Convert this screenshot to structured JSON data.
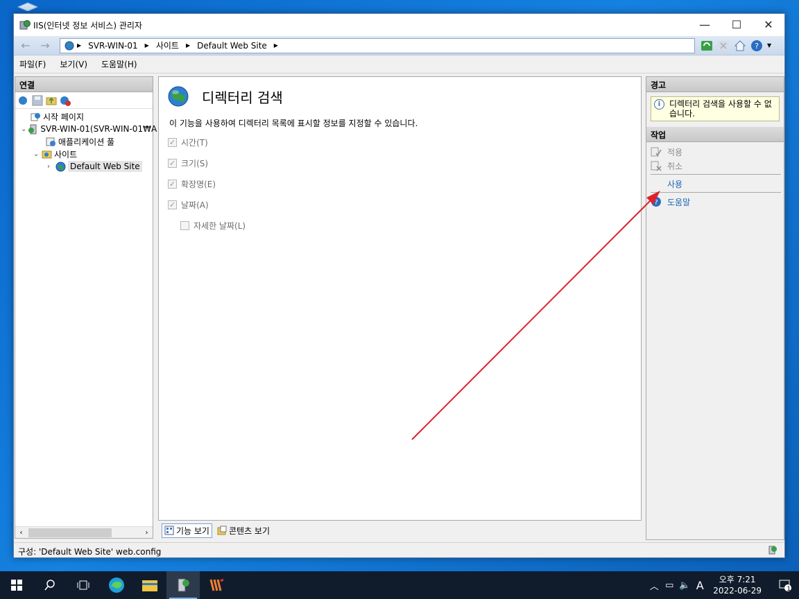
{
  "window": {
    "title": "IIS(인터넷 정보 서비스) 관리자",
    "controls": {
      "minimize": "—",
      "maximize": "☐",
      "close": "✕"
    }
  },
  "address": {
    "breadcrumbs": [
      "SVR-WIN-01",
      "사이트",
      "Default Web Site"
    ]
  },
  "menu": {
    "items": [
      "파일(F)",
      "보기(V)",
      "도움말(H)"
    ]
  },
  "connections": {
    "header": "연결",
    "tree": {
      "start_page": "시작 페이지",
      "server": "SVR-WIN-01(SVR-WIN-01₩A",
      "app_pools": "애플리케이션 풀",
      "sites": "사이트",
      "default_site": "Default Web Site"
    }
  },
  "feature": {
    "title": "디렉터리 검색",
    "description": "이 기능을 사용하여 디렉터리 목록에 표시할 정보를 지정할 수 있습니다.",
    "options": [
      {
        "label": "시간(T)",
        "checked": true
      },
      {
        "label": "크기(S)",
        "checked": true
      },
      {
        "label": "확장명(E)",
        "checked": true
      },
      {
        "label": "날짜(A)",
        "checked": true
      }
    ],
    "sub_option": {
      "label": "자세한 날짜(L)",
      "checked": false
    }
  },
  "view_tabs": {
    "features": "기능 보기",
    "content": "콘텐츠 보기"
  },
  "actions": {
    "alerts_header": "경고",
    "alert_text": "디렉터리 검색을 사용할 수 없습니다.",
    "tasks_header": "작업",
    "apply": "적용",
    "cancel": "취소",
    "enable": "사용",
    "help": "도움말"
  },
  "status": {
    "text": "구성: 'Default Web Site' web.config"
  },
  "taskbar": {
    "time": "오후 7:21",
    "date": "2022-06-29",
    "ime": "A",
    "notification_count": "1"
  },
  "colors": {
    "accent": "#1c64b4",
    "annotation_arrow": "#e0202a",
    "taskbar": "#101c2c"
  }
}
